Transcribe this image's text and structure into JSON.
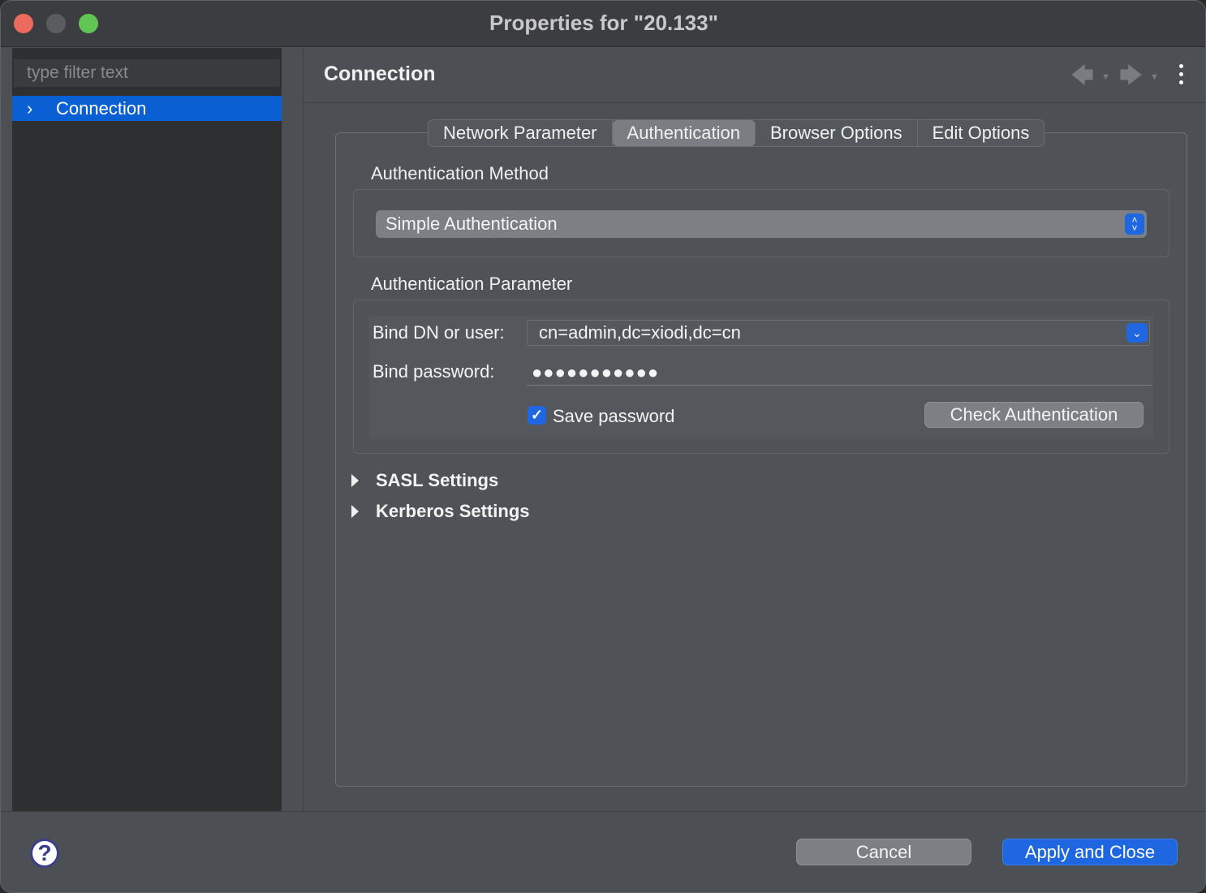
{
  "window": {
    "title": "Properties for \"20.133\""
  },
  "sidebar": {
    "filter_placeholder": "type filter text",
    "items": [
      {
        "label": "Connection",
        "selected": true
      }
    ]
  },
  "header": {
    "title": "Connection"
  },
  "tabs": [
    {
      "label": "Network Parameter",
      "active": false
    },
    {
      "label": "Authentication",
      "active": true
    },
    {
      "label": "Browser Options",
      "active": false
    },
    {
      "label": "Edit Options",
      "active": false
    }
  ],
  "auth_method": {
    "section_label": "Authentication Method",
    "selected": "Simple Authentication"
  },
  "auth_params": {
    "section_label": "Authentication Parameter",
    "bind_dn_label": "Bind DN or user:",
    "bind_dn_value": "cn=admin,dc=xiodi,dc=cn",
    "bind_password_label": "Bind password:",
    "bind_password_value": "●●●●●●●●●●●",
    "save_password_label": "Save password",
    "save_password_checked": true,
    "check_button": "Check Authentication"
  },
  "expanders": [
    {
      "label": "SASL Settings"
    },
    {
      "label": "Kerberos Settings"
    }
  ],
  "footer": {
    "cancel": "Cancel",
    "apply_close": "Apply and Close"
  },
  "colors": {
    "accent": "#1f67e0",
    "selection": "#0a5fd3"
  }
}
